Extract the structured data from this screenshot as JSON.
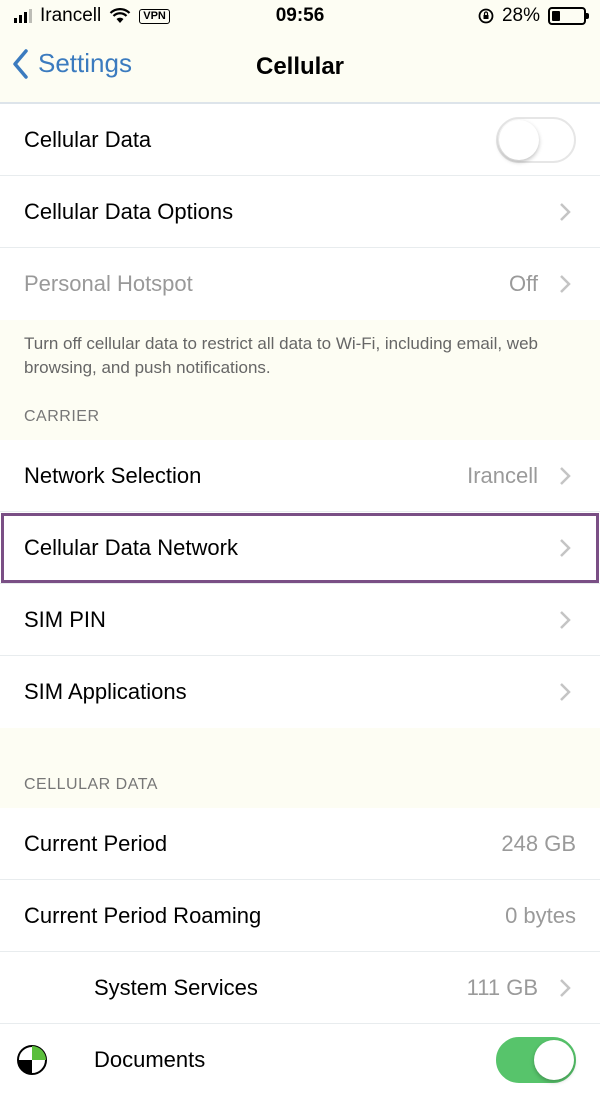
{
  "status": {
    "carrier": "Irancell",
    "vpn": "VPN",
    "time": "09:56",
    "battery_pct": "28%",
    "battery_level": 0.28
  },
  "nav": {
    "back_label": "Settings",
    "title": "Cellular"
  },
  "group1": {
    "cellular_data": {
      "label": "Cellular Data",
      "on": false
    },
    "cellular_data_options": {
      "label": "Cellular Data Options"
    },
    "personal_hotspot": {
      "label": "Personal Hotspot",
      "value": "Off"
    }
  },
  "note": "Turn off cellular data to restrict all data to Wi-Fi, including email, web browsing, and push notifications.",
  "carrier_header": "CARRIER",
  "carrier_rows": {
    "network_selection": {
      "label": "Network Selection",
      "value": "Irancell"
    },
    "cellular_data_network": {
      "label": "Cellular Data Network"
    },
    "sim_pin": {
      "label": "SIM PIN"
    },
    "sim_applications": {
      "label": "SIM Applications"
    }
  },
  "cellular_data_header": "CELLULAR DATA",
  "usage": {
    "current_period": {
      "label": "Current Period",
      "value": "248 GB"
    },
    "current_period_roaming": {
      "label": "Current Period Roaming",
      "value": "0 bytes"
    },
    "system_services": {
      "label": "System Services",
      "value": "111 GB"
    },
    "documents": {
      "label": "Documents",
      "on": true
    }
  }
}
